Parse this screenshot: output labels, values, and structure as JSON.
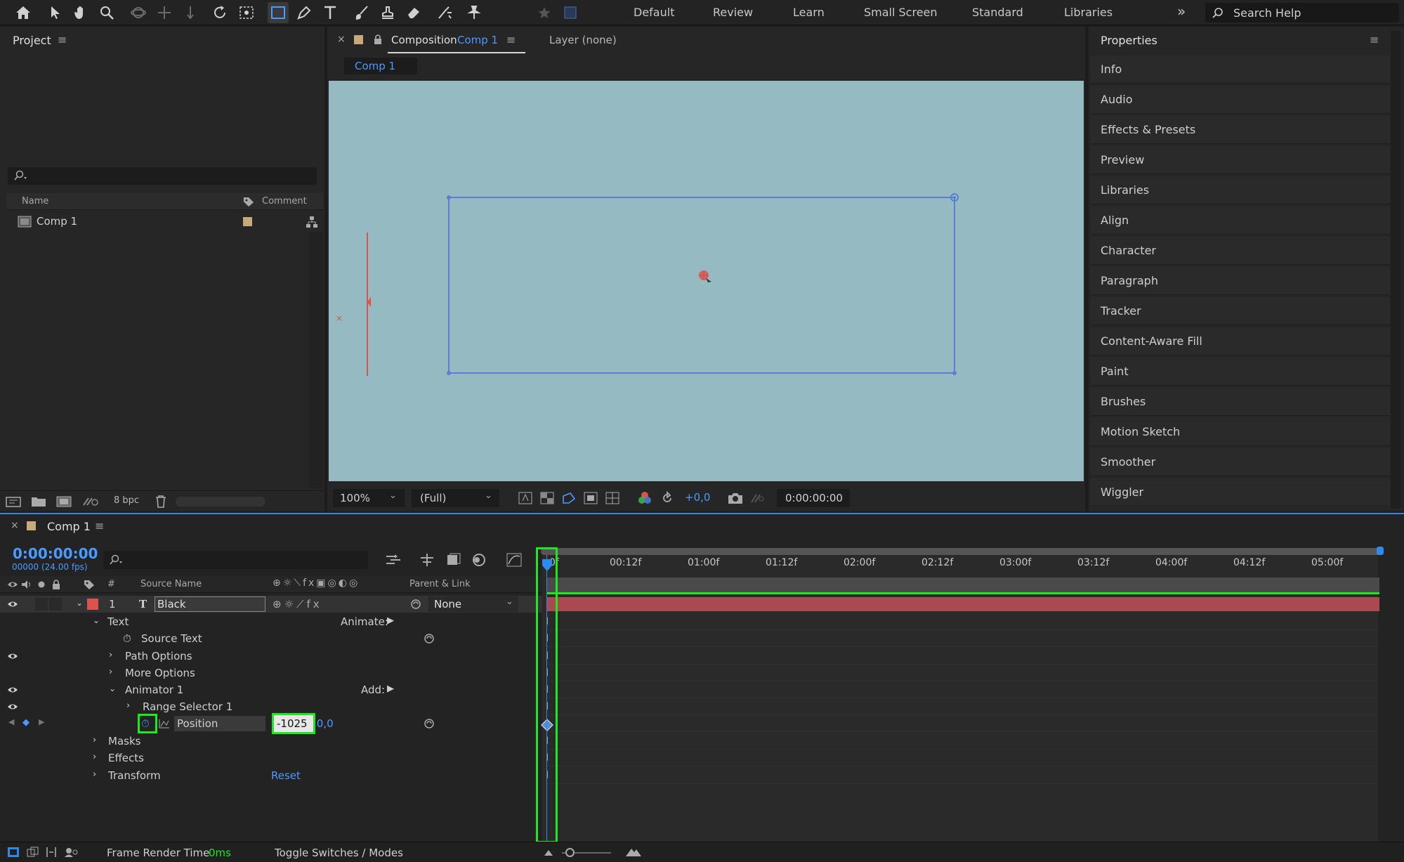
{
  "workspaces": [
    "Default",
    "Review",
    "Learn",
    "Small Screen",
    "Standard",
    "Libraries"
  ],
  "search_help": "Search Help",
  "project": {
    "title": "Project",
    "col_name": "Name",
    "col_comment": "Comment",
    "item": "Comp 1",
    "bpc": "8 bpc"
  },
  "composition": {
    "tab_label": "Composition",
    "tab_comp": "Comp 1",
    "layer_tab": "Layer (none)",
    "sub_tab": "Comp 1",
    "zoom": "100%",
    "resolution": "(Full)",
    "exposure": "+0,0",
    "timecode": "0:00:00:00"
  },
  "properties": {
    "title": "Properties",
    "items": [
      "Info",
      "Audio",
      "Effects & Presets",
      "Preview",
      "Libraries",
      "Align",
      "Character",
      "Paragraph",
      "Tracker",
      "Content-Aware Fill",
      "Paint",
      "Brushes",
      "Motion Sketch",
      "Smoother",
      "Wiggler"
    ]
  },
  "timeline": {
    "tab": "Comp 1",
    "timecode": "0:00:00:00",
    "frames": "00000 (24.00 fps)",
    "col_hash": "#",
    "col_source": "Source Name",
    "col_parent": "Parent & Link",
    "ticks": [
      "0f",
      "00:12f",
      "01:00f",
      "01:12f",
      "02:00f",
      "02:12f",
      "03:00f",
      "03:12f",
      "04:00f",
      "04:12f",
      "05:00f"
    ],
    "layer": {
      "number": "1",
      "name": "Black",
      "parent": "None"
    },
    "rows": {
      "text": "Text",
      "animate": "Animate:",
      "source_text": "Source Text",
      "path_options": "Path Options",
      "more_options": "More Options",
      "animator": "Animator 1",
      "add": "Add:",
      "range_selector": "Range Selector 1",
      "position": "Position",
      "position_x": "-1025",
      "position_y": ",0,0",
      "masks": "Masks",
      "effects": "Effects",
      "transform": "Transform",
      "reset": "Reset"
    },
    "footer_render": "Frame Render Time",
    "footer_ms": "0ms",
    "footer_toggle": "Toggle Switches / Modes"
  },
  "colors": {
    "accent_blue": "#2d8ceb",
    "viewer_bg": "#96bac1",
    "layer_bar": "#a84a50",
    "highlight_green": "#1ee81e",
    "label_red": "#d9534f"
  }
}
